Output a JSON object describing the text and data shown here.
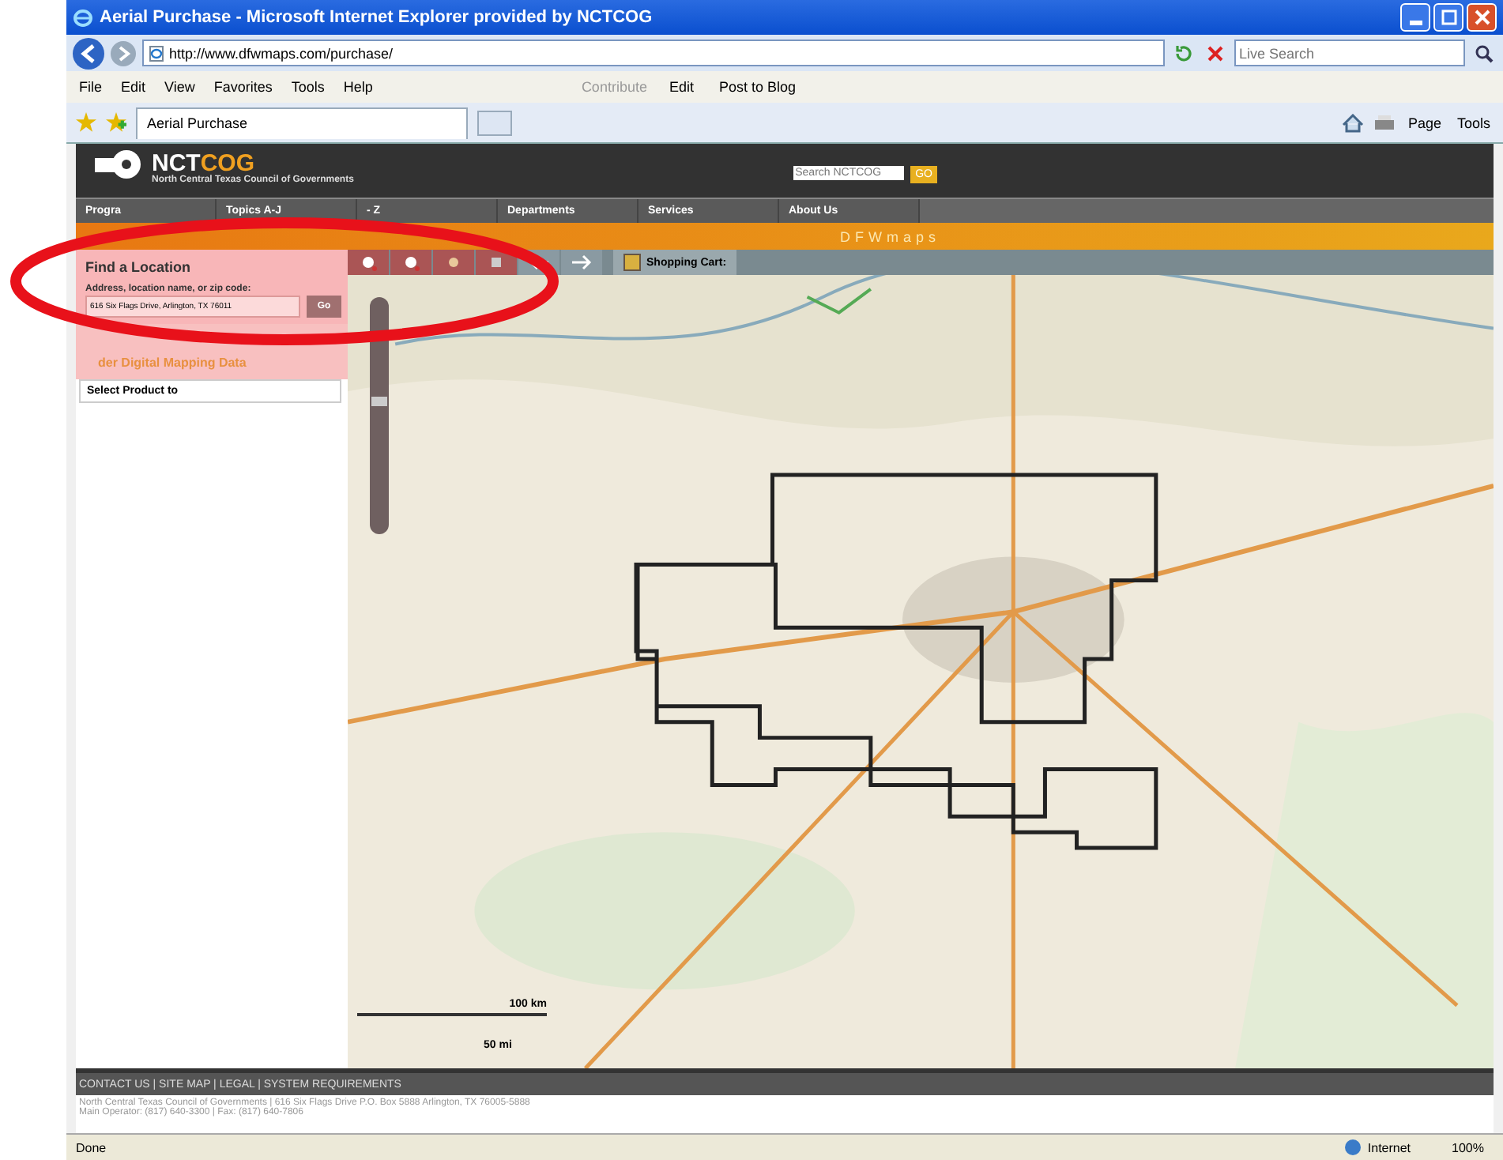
{
  "window": {
    "title": "Aerial Purchase - Microsoft Internet Explorer provided by NCTCOG"
  },
  "address_bar": {
    "url": "http://www.dfwmaps.com/purchase/",
    "search_placeholder": "Live Search"
  },
  "menu": [
    "File",
    "Edit",
    "View",
    "Favorites",
    "Tools",
    "Help"
  ],
  "links_bar": {
    "label": "Contribute",
    "items": [
      "Edit",
      "Post to Blog"
    ]
  },
  "tabs": [
    {
      "label": "Aerial Purchase",
      "selected": true
    }
  ],
  "command_bar": [
    "Page",
    "Tools"
  ],
  "site": {
    "logo_parts": [
      "NCT",
      "COG"
    ],
    "subtitle": "North Central Texas Council of Governments",
    "search_placeholder": "Search NCTCOG",
    "search_button": "GO",
    "nav": [
      "Progra",
      "Topics A-J",
      "- Z",
      "Departments",
      "Services",
      "About Us"
    ],
    "banner": "DFWmaps"
  },
  "find_panel": {
    "title": "Find a Location",
    "label": "Address, location name, or zip code:",
    "value": "616 Six Flags Drive, Arlington, TX 76011",
    "button": "Go",
    "section": "der Digital Mapping Data",
    "select": "Select Product to"
  },
  "map": {
    "kind": "picture",
    "zoom": {
      "level": 0.55
    },
    "cart": "Shopping Cart:",
    "scale": [
      "100 km",
      "50 mi"
    ]
  },
  "footer": {
    "links": "CONTACT US | SITE MAP | LEGAL | SYSTEM REQUIREMENTS",
    "lines": [
      "North Central Texas Council of Governments | 616 Six Flags Drive P.O. Box 5888 Arlington, TX 76005-5888",
      "Main Operator: (817) 640-3300 | Fax: (817) 640-7806"
    ]
  },
  "status_bar": {
    "text": "Done",
    "zone": "Internet",
    "zoom": "100%"
  }
}
